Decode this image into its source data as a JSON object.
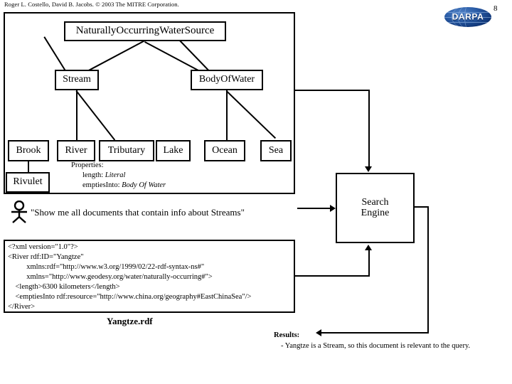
{
  "header": {
    "credit": "Roger L. Costello, David B. Jacobs. © 2003 The MITRE Corporation.",
    "page_number": "8",
    "logo_text": "DARPA",
    "logo_name": "darpa-logo",
    "logo_color": "#1d4f9c"
  },
  "ontology": {
    "root": "NaturallyOccurringWaterSource",
    "level2": [
      {
        "label": "Stream"
      },
      {
        "label": "BodyOfWater"
      }
    ],
    "leaves": [
      {
        "label": "Brook"
      },
      {
        "label": "River"
      },
      {
        "label": "Tributary"
      },
      {
        "label": "Lake"
      },
      {
        "label": "Ocean"
      },
      {
        "label": "Sea"
      }
    ],
    "sub_leaf": {
      "label": "Rivulet"
    },
    "properties": {
      "heading": "Properties:",
      "items": [
        {
          "name": "length:",
          "value": "Literal"
        },
        {
          "name": "emptiesInto:",
          "value": "Body Of Water"
        }
      ]
    }
  },
  "query": {
    "person_icon": "stick-figure-icon",
    "text": "\"Show me all documents that contain info about Streams\""
  },
  "rdf_document": {
    "caption": "Yangtze.rdf",
    "lines": [
      "<?xml version=\"1.0\"?>",
      "<River rdf:ID=\"Yangtze\"",
      "          xmlns:rdf=\"http://www.w3.org/1999/02/22-rdf-syntax-ns#\"",
      "          xmlns=\"http://www.geodesy.org/water/naturally-occurring#\">",
      "    <length>6300 kilometers</length>",
      "    <emptiesInto rdf:resource=\"http://www.china.org/geography#EastChinaSea\"/>",
      "</River>"
    ]
  },
  "search_engine": {
    "line1": "Search",
    "line2": "Engine"
  },
  "results": {
    "label": "Results:",
    "text": "- Yangtze is a Stream, so this document is relevant to the query."
  }
}
